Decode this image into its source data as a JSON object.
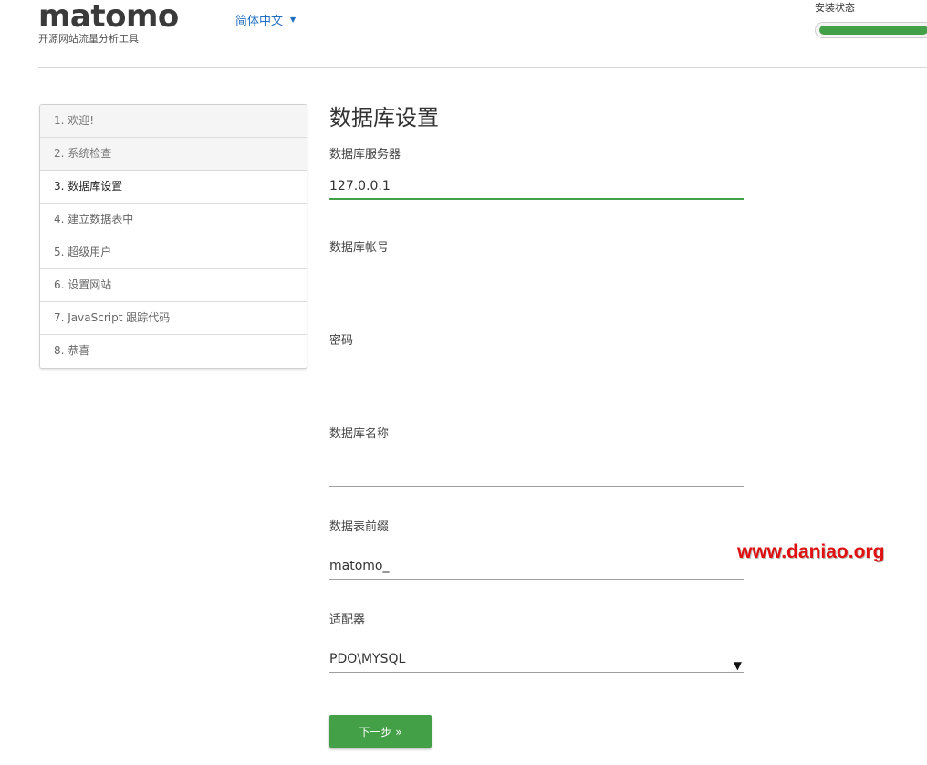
{
  "header": {
    "logo_text": "matomo",
    "tagline": "开源网站流量分析工具",
    "language": "简体中文",
    "install_status_label": "安装状态",
    "install_progress": 1.0
  },
  "steps": [
    {
      "label": "1. 欢迎!",
      "state": "done"
    },
    {
      "label": "2. 系统检查",
      "state": "done"
    },
    {
      "label": "3. 数据库设置",
      "state": "current"
    },
    {
      "label": "4. 建立数据表中",
      "state": "future"
    },
    {
      "label": "5. 超级用户",
      "state": "future"
    },
    {
      "label": "6. 设置网站",
      "state": "future"
    },
    {
      "label": "7. JavaScript 跟踪代码",
      "state": "future"
    },
    {
      "label": "8. 恭喜",
      "state": "future"
    }
  ],
  "form": {
    "title": "数据库设置",
    "fields": {
      "host": {
        "label": "数据库服务器",
        "value": "127.0.0.1"
      },
      "username": {
        "label": "数据库帐号",
        "value": ""
      },
      "password": {
        "label": "密码",
        "value": ""
      },
      "dbname": {
        "label": "数据库名称",
        "value": ""
      },
      "prefix": {
        "label": "数据表前缀",
        "value": "matomo_"
      },
      "adapter": {
        "label": "适配器",
        "value": "PDO\\MYSQL"
      }
    },
    "next_button": "下一步 »"
  },
  "watermark": "www.daniao.org",
  "colors": {
    "accent": "#43a047",
    "link": "#1e6fc1",
    "watermark": "#e01010"
  }
}
